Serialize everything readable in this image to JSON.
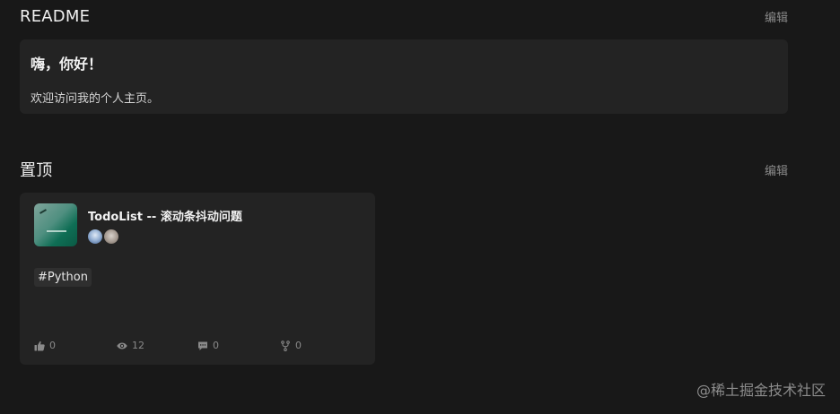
{
  "readme": {
    "title": "README",
    "edit_label": "编辑",
    "heading": "嗨，你好！",
    "text": "欢迎访问我的个人主页。"
  },
  "pinned": {
    "title": "置顶",
    "edit_label": "编辑",
    "project": {
      "title": "TodoList -- 滚动条抖动问题",
      "tag": "#Python",
      "likes": "0",
      "views": "12",
      "comments": "0",
      "forks": "0"
    }
  },
  "watermark": "@稀土掘金技术社区"
}
